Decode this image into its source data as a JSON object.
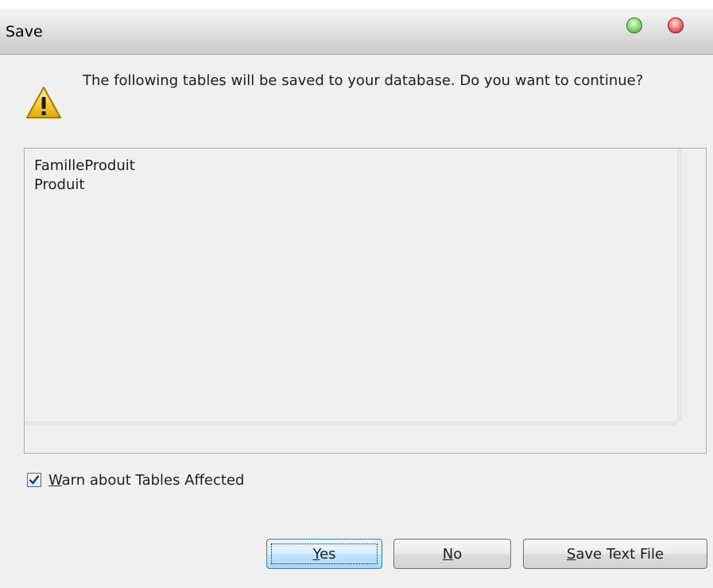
{
  "window": {
    "title": "Save"
  },
  "message": {
    "text": "The following tables will be saved to your database. Do you want to continue?"
  },
  "tables_list": {
    "items": [
      "FamilleProduit",
      "Produit"
    ]
  },
  "warn_checkbox": {
    "checked": true,
    "label_accel": "W",
    "label_rest": "arn about Tables Affected"
  },
  "buttons": {
    "yes": {
      "accel": "Y",
      "rest": "es"
    },
    "no": {
      "accel": "N",
      "rest": "o"
    },
    "save_text_file": {
      "accel": "S",
      "rest": "ave Text File"
    }
  },
  "icons": {
    "warning": "warning-icon",
    "maximize": "green-circle-icon",
    "close": "red-circle-icon",
    "check": "checkmark-icon"
  },
  "colors": {
    "default_button_border": "#3c7fb1",
    "default_button_fill": "#bee6fd",
    "close_button": "#e05050",
    "maximize_button": "#7fd06a",
    "warning_yellow": "#f6d23a"
  }
}
